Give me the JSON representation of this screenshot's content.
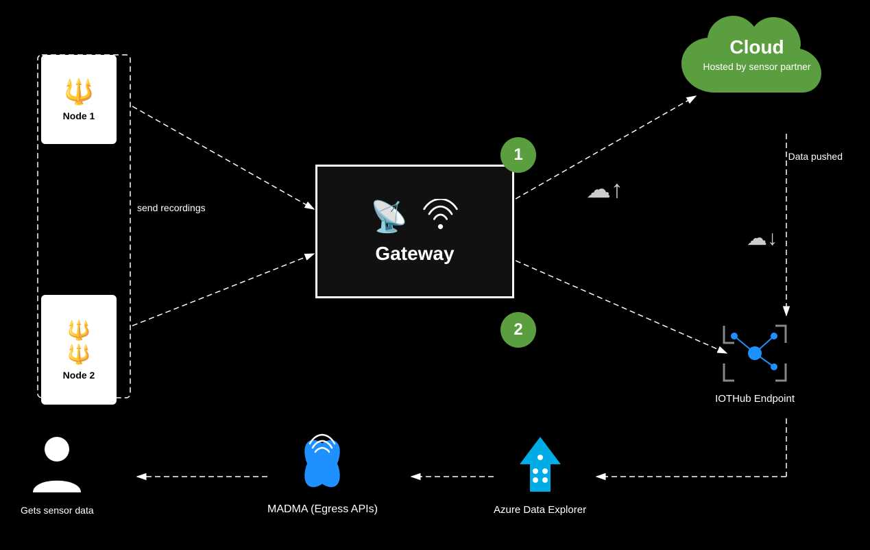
{
  "cloud": {
    "title": "Cloud",
    "subtitle": "Hosted by sensor partner"
  },
  "nodes": [
    {
      "id": "node1",
      "label": "Node 1"
    },
    {
      "id": "node2",
      "label": "Node 2"
    }
  ],
  "gateway": {
    "label": "Gateway"
  },
  "steps": [
    {
      "number": "1"
    },
    {
      "number": "2"
    }
  ],
  "labels": {
    "send_recordings": "send recordings",
    "data_pushed": "Data pushed",
    "iothub": "IOTHub Endpoint",
    "madma": "MADMA   (Egress APIs)",
    "azure": "Azure Data Explorer",
    "user": "Gets sensor data"
  }
}
